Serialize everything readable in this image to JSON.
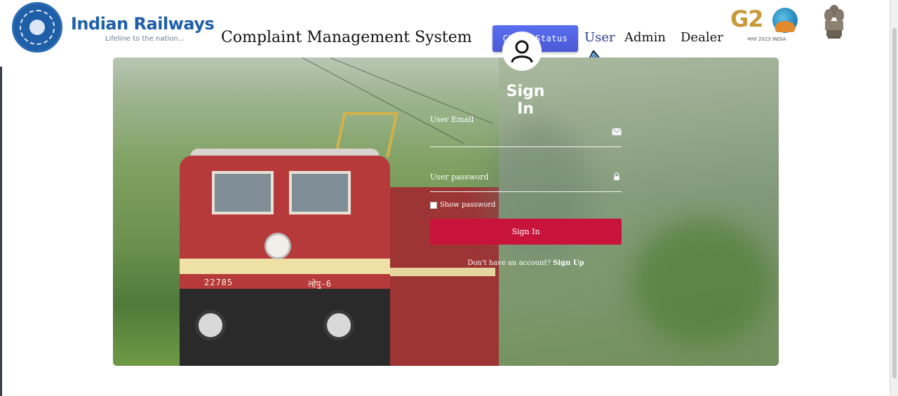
{
  "brand": {
    "name": "Indian Railways",
    "tagline": "Lifeline to the nation..."
  },
  "header": {
    "title": "Complaint Management System",
    "check_status_label": "Check Status",
    "nav": {
      "user": "User",
      "admin": "Admin",
      "dealer": "Dealer"
    }
  },
  "g20": {
    "text": "G2",
    "sub": "भारत 2023 INDIA"
  },
  "hero": {
    "loco_number": "22785",
    "loco_number_local": "ल्हेपु-6"
  },
  "signin": {
    "title": "Sign In",
    "email_label": "User Email",
    "email_value": "",
    "password_label": "User password",
    "password_value": "",
    "show_password_label": "Show password",
    "button_label": "Sign In",
    "no_account_text": "Don't have an account?",
    "signup_label": "Sign Up"
  },
  "colors": {
    "accent_button": "#4a59d6",
    "signin_button": "#c8143b",
    "brand_blue": "#1f5fa8"
  },
  "icons": [
    "railways-logo-icon",
    "arrow-curve-icon",
    "g20-logo-icon",
    "emblem-icon",
    "user-avatar-icon",
    "envelope-icon",
    "lock-icon"
  ]
}
